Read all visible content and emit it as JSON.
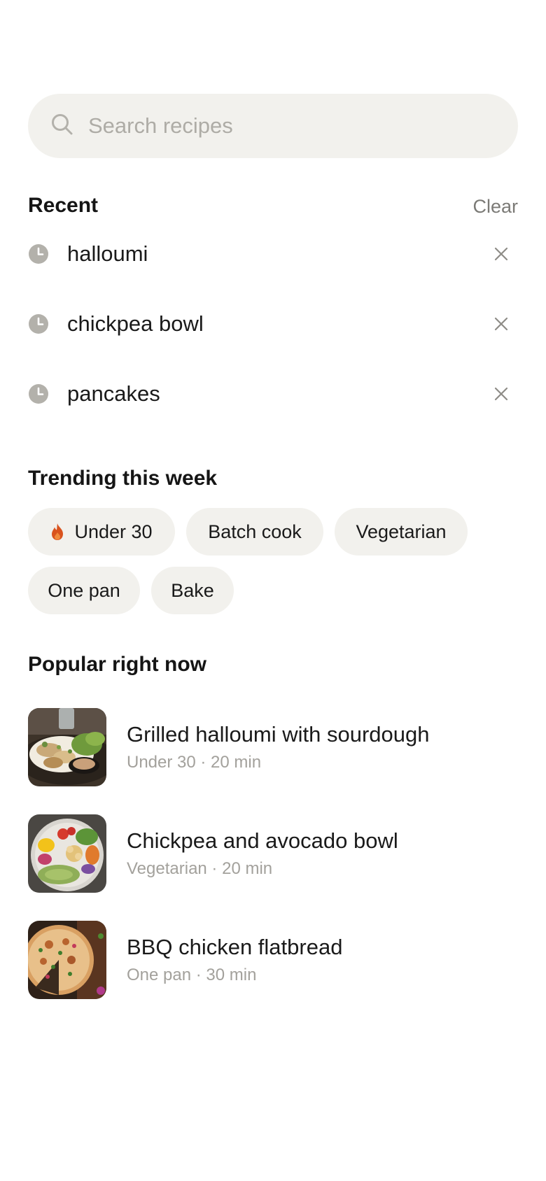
{
  "search": {
    "placeholder": "Search recipes",
    "value": ""
  },
  "recent": {
    "heading": "Recent",
    "clear_label": "Clear",
    "items": [
      {
        "label": "halloumi"
      },
      {
        "label": "chickpea bowl"
      },
      {
        "label": "pancakes"
      }
    ]
  },
  "trending": {
    "heading": "Trending this week",
    "chips": [
      {
        "label": "Under 30",
        "icon": "flame-icon"
      },
      {
        "label": "Batch cook"
      },
      {
        "label": "Vegetarian"
      },
      {
        "label": "One pan"
      },
      {
        "label": "Bake"
      }
    ]
  },
  "popular": {
    "heading": "Popular right now",
    "items": [
      {
        "title": "Grilled halloumi with sourdough",
        "meta": "Under 30 · 20 min",
        "image": "halloumi-thumbnail"
      },
      {
        "title": "Chickpea and avocado bowl",
        "meta": "Vegetarian · 20 min",
        "image": "chickpea-bowl-thumbnail"
      },
      {
        "title": "BBQ chicken flatbread",
        "meta": "One pan · 30 min",
        "image": "flatbread-thumbnail"
      }
    ]
  },
  "colors": {
    "surface": "#f2f1ed",
    "accent_flame": "#d9531e",
    "muted_text": "#a3a19c",
    "icon_gray": "#b3b1ab"
  }
}
